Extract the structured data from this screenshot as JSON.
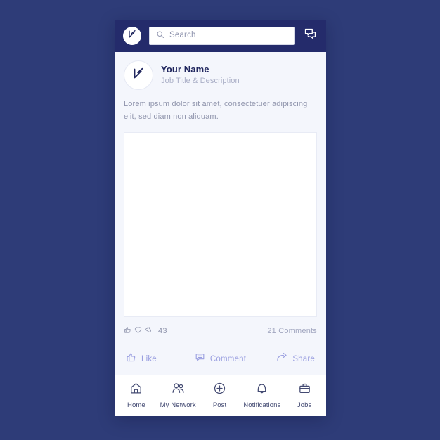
{
  "theme": {
    "backdrop": "#2e3c78",
    "appbar_bg": "#242b6b",
    "card_bg": "#f4f6fc",
    "brand_navy": "#20265e",
    "muted_text": "#8f94ac",
    "action_periwinkle": "#9a9fe0",
    "nav_text": "#434a72",
    "media_bg": "#ffffff"
  },
  "appbar": {
    "brand_icon": "brand-logo-icon",
    "search": {
      "icon": "search-icon",
      "placeholder": "Search",
      "value": ""
    },
    "messages_icon": "messages-icon"
  },
  "post": {
    "avatar_icon": "brand-logo-icon",
    "author_name": "Your Name",
    "author_title": "Job Title & Description",
    "body": "Lorem ipsum dolor sit amet, consectetuer adipiscing elit, sed diam non aliquam.",
    "media_placeholder": "post-image-placeholder",
    "reactions": {
      "icons": [
        "thumbs-up-icon",
        "heart-icon",
        "clap-icon"
      ],
      "count": "43",
      "comments": "21 Comments"
    },
    "actions": [
      {
        "label": "Like",
        "icon": "thumbs-up-icon"
      },
      {
        "label": "Comment",
        "icon": "comment-icon"
      },
      {
        "label": "Share",
        "icon": "share-icon"
      }
    ]
  },
  "bottom_nav": [
    {
      "label": "Home",
      "icon": "home-icon"
    },
    {
      "label": "My Network",
      "icon": "people-icon"
    },
    {
      "label": "Post",
      "icon": "plus-circle-icon"
    },
    {
      "label": "Notifications",
      "icon": "bell-icon"
    },
    {
      "label": "Jobs",
      "icon": "briefcase-icon"
    }
  ]
}
